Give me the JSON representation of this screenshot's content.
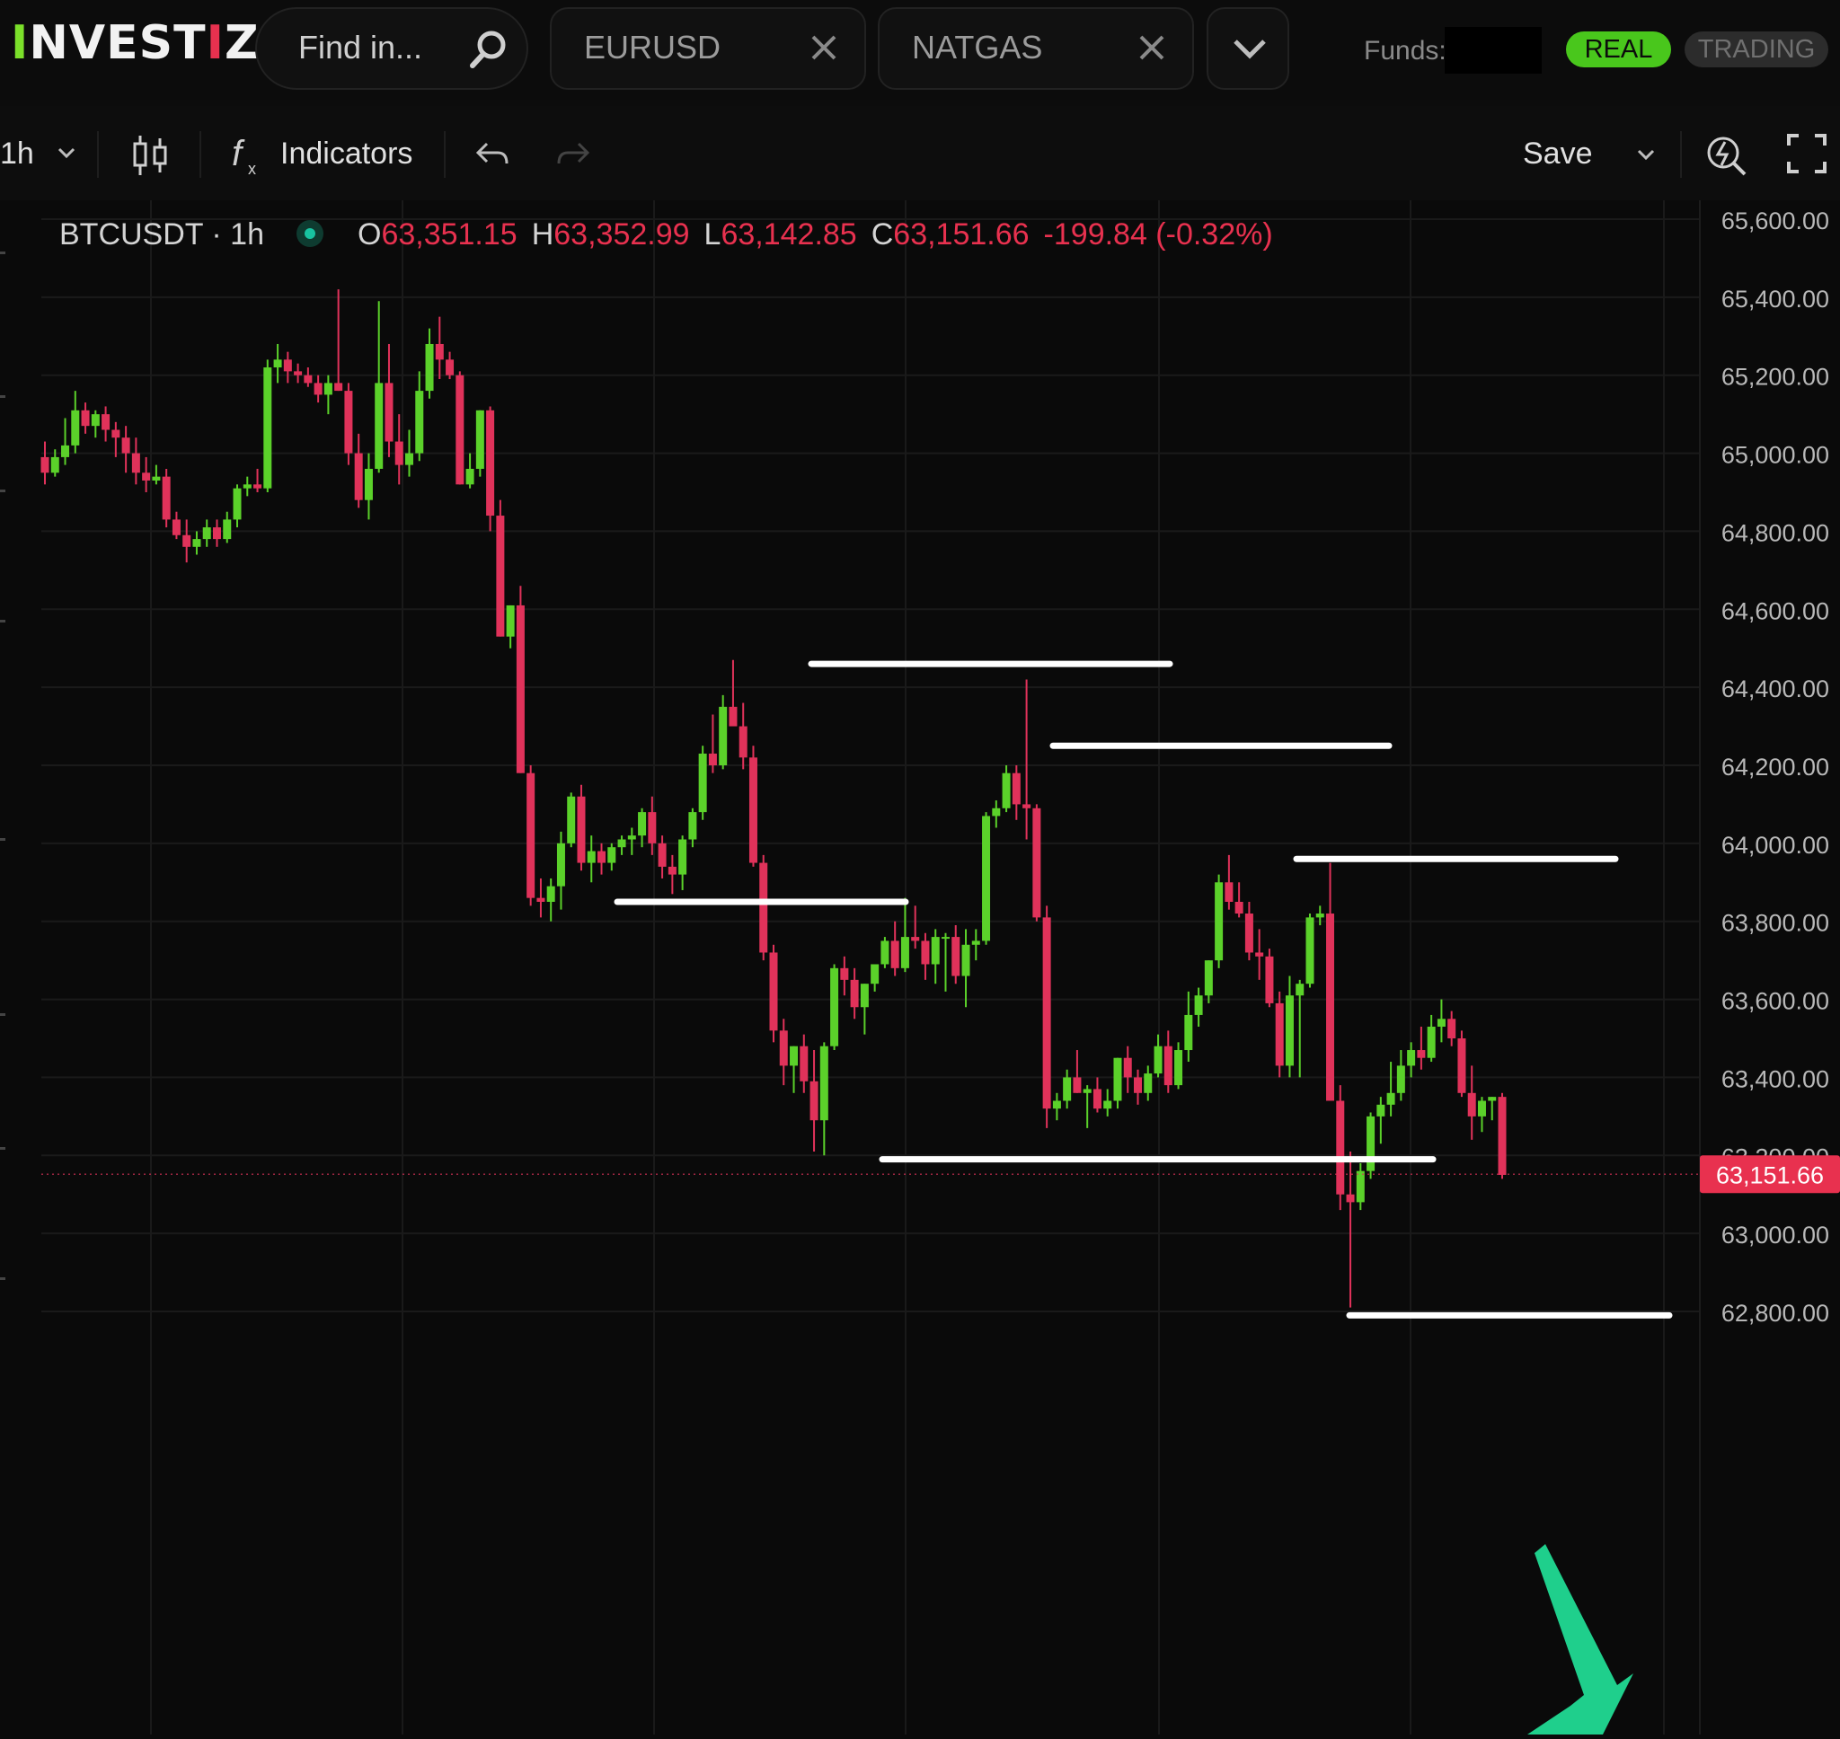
{
  "header": {
    "logo_text": "INVESTIZO",
    "search": {
      "label": "Find in..."
    },
    "tabs": [
      {
        "label": "EURUSD"
      },
      {
        "label": "NATGAS"
      }
    ],
    "funds_label": "Funds:",
    "mode_buttons": {
      "real": "REAL",
      "trading": "TRADING"
    },
    "colors": {
      "brand_green": "#7be02a",
      "brand_red": "#e8314f",
      "real_active": "#49c71c"
    }
  },
  "toolbar": {
    "interval": "1h",
    "indicators_label": "Indicators",
    "save_label": "Save",
    "icons": [
      "chevron-down-icon",
      "candles-icon",
      "fx-icon",
      "undo-icon",
      "redo-icon",
      "chevron-down-icon",
      "alert-icon",
      "fullscreen-icon"
    ]
  },
  "legend": {
    "symbol": "BTCUSDT · 1h",
    "open_key": "O",
    "open": "63,351.15",
    "high_key": "H",
    "high": "63,352.99",
    "low_key": "L",
    "low": "63,142.85",
    "close_key": "C",
    "close": "63,151.66",
    "change": "-199.84 (-0.32%)"
  },
  "price_axis": {
    "ticks": [
      "65,600.00",
      "65,400.00",
      "65,200.00",
      "65,000.00",
      "64,800.00",
      "64,600.00",
      "64,400.00",
      "64,200.00",
      "64,000.00",
      "63,800.00",
      "63,600.00",
      "63,400.00",
      "63,200.00",
      "63,000.00",
      "62,800.00"
    ],
    "current_price_label": "63,151.66"
  },
  "chart_data": {
    "type": "candlestick",
    "symbol": "BTCUSDT",
    "interval": "1h",
    "ylim": [
      62750,
      65700
    ],
    "up_color": "#5bd12a",
    "down_color": "#e0325a",
    "last_price": 63151.66,
    "candles": [
      [
        64990,
        65030,
        64920,
        64950
      ],
      [
        64950,
        65010,
        64940,
        64990
      ],
      [
        64990,
        65090,
        64970,
        65020
      ],
      [
        65020,
        65160,
        65000,
        65110
      ],
      [
        65110,
        65130,
        65050,
        65070
      ],
      [
        65070,
        65110,
        65040,
        65100
      ],
      [
        65100,
        65120,
        65030,
        65060
      ],
      [
        65060,
        65080,
        64990,
        65040
      ],
      [
        65040,
        65070,
        64950,
        65000
      ],
      [
        65000,
        65040,
        64920,
        64950
      ],
      [
        64950,
        64990,
        64900,
        64930
      ],
      [
        64930,
        64970,
        64920,
        64940
      ],
      [
        64940,
        64960,
        64810,
        64830
      ],
      [
        64830,
        64850,
        64780,
        64790
      ],
      [
        64790,
        64830,
        64720,
        64760
      ],
      [
        64760,
        64800,
        64740,
        64780
      ],
      [
        64780,
        64830,
        64760,
        64810
      ],
      [
        64810,
        64830,
        64760,
        64780
      ],
      [
        64780,
        64850,
        64770,
        64830
      ],
      [
        64830,
        64920,
        64810,
        64910
      ],
      [
        64910,
        64940,
        64890,
        64920
      ],
      [
        64920,
        64960,
        64900,
        64910
      ],
      [
        64910,
        65240,
        64900,
        65220
      ],
      [
        65220,
        65280,
        65180,
        65240
      ],
      [
        65240,
        65260,
        65180,
        65210
      ],
      [
        65210,
        65230,
        65180,
        65200
      ],
      [
        65200,
        65220,
        65170,
        65180
      ],
      [
        65180,
        65200,
        65130,
        65150
      ],
      [
        65150,
        65200,
        65100,
        65180
      ],
      [
        65180,
        65420,
        65160,
        65160
      ],
      [
        65160,
        65180,
        64970,
        65000
      ],
      [
        65000,
        65050,
        64860,
        64880
      ],
      [
        64880,
        65000,
        64830,
        64960
      ],
      [
        64960,
        65390,
        64950,
        65180
      ],
      [
        65180,
        65280,
        64990,
        65030
      ],
      [
        65030,
        65100,
        64920,
        64970
      ],
      [
        64970,
        65060,
        64940,
        65000
      ],
      [
        65000,
        65210,
        64980,
        65160
      ],
      [
        65160,
        65320,
        65140,
        65280
      ],
      [
        65280,
        65350,
        65190,
        65240
      ],
      [
        65240,
        65260,
        65190,
        65200
      ],
      [
        65200,
        65210,
        64920,
        64920
      ],
      [
        64920,
        65000,
        64910,
        64960
      ],
      [
        64960,
        65110,
        64940,
        65110
      ],
      [
        65110,
        65120,
        64800,
        64840
      ],
      [
        64840,
        64880,
        64530,
        64530
      ],
      [
        64530,
        64610,
        64500,
        64610
      ],
      [
        64610,
        64660,
        64180,
        64180
      ],
      [
        64180,
        64200,
        63840,
        63860
      ],
      [
        63860,
        63910,
        63810,
        63850
      ],
      [
        63850,
        63910,
        63800,
        63890
      ],
      [
        63890,
        64030,
        63830,
        64000
      ],
      [
        64000,
        64130,
        63990,
        64120
      ],
      [
        64120,
        64150,
        63930,
        63950
      ],
      [
        63950,
        64020,
        63900,
        63980
      ],
      [
        63980,
        64000,
        63920,
        63950
      ],
      [
        63950,
        64000,
        63930,
        63990
      ],
      [
        63990,
        64020,
        63970,
        64010
      ],
      [
        64010,
        64040,
        63970,
        64020
      ],
      [
        64020,
        64090,
        63990,
        64080
      ],
      [
        64080,
        64120,
        63970,
        64000
      ],
      [
        64000,
        64020,
        63910,
        63940
      ],
      [
        63940,
        63970,
        63870,
        63920
      ],
      [
        63920,
        64020,
        63880,
        64010
      ],
      [
        64010,
        64090,
        63990,
        64080
      ],
      [
        64080,
        64250,
        64060,
        64230
      ],
      [
        64230,
        64330,
        64180,
        64200
      ],
      [
        64200,
        64380,
        64190,
        64350
      ],
      [
        64350,
        64470,
        64320,
        64300
      ],
      [
        64300,
        64360,
        64190,
        64220
      ],
      [
        64220,
        64250,
        63940,
        63950
      ],
      [
        63950,
        63970,
        63700,
        63720
      ],
      [
        63720,
        63740,
        63490,
        63520
      ],
      [
        63520,
        63550,
        63380,
        63430
      ],
      [
        63430,
        63480,
        63360,
        63480
      ],
      [
        63480,
        63510,
        63360,
        63390
      ],
      [
        63390,
        63470,
        63210,
        63290
      ],
      [
        63290,
        63490,
        63200,
        63480
      ],
      [
        63480,
        63690,
        63470,
        63680
      ],
      [
        63680,
        63710,
        63610,
        63650
      ],
      [
        63650,
        63680,
        63550,
        63580
      ],
      [
        63580,
        63640,
        63510,
        63640
      ],
      [
        63640,
        63690,
        63620,
        63690
      ],
      [
        63690,
        63760,
        63680,
        63750
      ],
      [
        63750,
        63800,
        63660,
        63680
      ],
      [
        63680,
        63860,
        63670,
        63760
      ],
      [
        63760,
        63840,
        63730,
        63750
      ],
      [
        63750,
        63770,
        63650,
        63690
      ],
      [
        63690,
        63780,
        63640,
        63760
      ],
      [
        63760,
        63770,
        63620,
        63760
      ],
      [
        63760,
        63790,
        63640,
        63660
      ],
      [
        63660,
        63780,
        63580,
        63740
      ],
      [
        63740,
        63780,
        63700,
        63750
      ],
      [
        63750,
        64080,
        63740,
        64070
      ],
      [
        64070,
        64110,
        64040,
        64090
      ],
      [
        64090,
        64200,
        64080,
        64180
      ],
      [
        64180,
        64200,
        64060,
        64100
      ],
      [
        64100,
        64420,
        64010,
        64090
      ],
      [
        64090,
        64100,
        63800,
        63810
      ],
      [
        63810,
        63840,
        63270,
        63320
      ],
      [
        63320,
        63360,
        63290,
        63340
      ],
      [
        63340,
        63420,
        63320,
        63400
      ],
      [
        63400,
        63470,
        63360,
        63360
      ],
      [
        63360,
        63380,
        63270,
        63370
      ],
      [
        63370,
        63400,
        63310,
        63320
      ],
      [
        63320,
        63370,
        63300,
        63340
      ],
      [
        63340,
        63450,
        63320,
        63450
      ],
      [
        63450,
        63480,
        63360,
        63400
      ],
      [
        63400,
        63420,
        63330,
        63360
      ],
      [
        63360,
        63430,
        63340,
        63410
      ],
      [
        63410,
        63510,
        63400,
        63480
      ],
      [
        63480,
        63520,
        63360,
        63380
      ],
      [
        63380,
        63490,
        63370,
        63470
      ],
      [
        63470,
        63620,
        63440,
        63560
      ],
      [
        63560,
        63630,
        63530,
        63610
      ],
      [
        63610,
        63700,
        63590,
        63700
      ],
      [
        63700,
        63920,
        63680,
        63900
      ],
      [
        63900,
        63970,
        63830,
        63850
      ],
      [
        63850,
        63900,
        63810,
        63820
      ],
      [
        63820,
        63850,
        63700,
        63720
      ],
      [
        63720,
        63780,
        63650,
        63710
      ],
      [
        63710,
        63730,
        63580,
        63590
      ],
      [
        63590,
        63620,
        63400,
        63430
      ],
      [
        63430,
        63660,
        63400,
        63610
      ],
      [
        63610,
        63650,
        63400,
        63640
      ],
      [
        63640,
        63820,
        63630,
        63810
      ],
      [
        63810,
        63840,
        63790,
        63820
      ],
      [
        63820,
        63950,
        63420,
        63340
      ],
      [
        63340,
        63380,
        63060,
        63100
      ],
      [
        63100,
        63210,
        62810,
        63080
      ],
      [
        63080,
        63180,
        63060,
        63160
      ],
      [
        63160,
        63310,
        63140,
        63300
      ],
      [
        63300,
        63350,
        63230,
        63330
      ],
      [
        63330,
        63440,
        63300,
        63360
      ],
      [
        63360,
        63470,
        63340,
        63430
      ],
      [
        63430,
        63490,
        63400,
        63470
      ],
      [
        63470,
        63530,
        63420,
        63450
      ],
      [
        63450,
        63560,
        63440,
        63530
      ],
      [
        63530,
        63600,
        63490,
        63550
      ],
      [
        63550,
        63570,
        63480,
        63500
      ],
      [
        63500,
        63520,
        63350,
        63360
      ],
      [
        63360,
        63430,
        63240,
        63300
      ],
      [
        63300,
        63350,
        63260,
        63340
      ],
      [
        63340,
        63350,
        63290,
        63350
      ],
      [
        63350,
        63360,
        63140,
        63150
      ]
    ],
    "drawn_levels": [
      {
        "price": 64460
      },
      {
        "price": 64250
      },
      {
        "price": 63960
      },
      {
        "price": 63850
      },
      {
        "price": 63190
      },
      {
        "price": 62790
      }
    ]
  }
}
